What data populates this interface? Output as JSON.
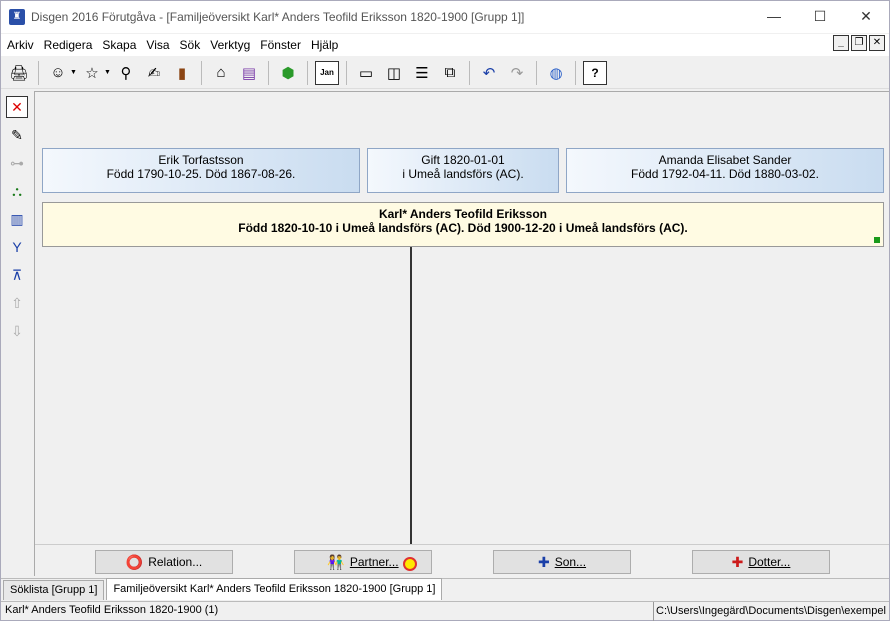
{
  "window": {
    "title": "Disgen 2016 Förutgåva - [Familjeöversikt Karl* Anders Teofild Eriksson 1820-1900 [Grupp 1]]"
  },
  "menu": [
    "Arkiv",
    "Redigera",
    "Skapa",
    "Visa",
    "Sök",
    "Verktyg",
    "Fönster",
    "Hjälp"
  ],
  "toolbar": {
    "calendar_label": "Jan"
  },
  "family": {
    "father": {
      "name": "Erik Torfastsson",
      "details": "Född 1790-10-25. Död 1867-08-26."
    },
    "marriage": {
      "line1": "Gift 1820-01-01",
      "line2": "i  Umeå landsförs (AC)."
    },
    "mother": {
      "name": "Amanda Elisabet Sander",
      "details": "Född 1792-04-11. Död 1880-03-02."
    },
    "main": {
      "name": "Karl* Anders Teofild Eriksson",
      "details": "Född 1820-10-10 i Umeå landsförs (AC). Död 1900-12-20 i Umeå landsförs (AC)."
    }
  },
  "buttons": {
    "relation": "Relation...",
    "partner": "Partner...",
    "son": "Son...",
    "daughter": "Dotter..."
  },
  "tabs": [
    "Söklista [Grupp 1]",
    "Familjeöversikt Karl* Anders Teofild Eriksson 1820-1900 [Grupp 1]"
  ],
  "status": {
    "left": "Karl* Anders Teofild Eriksson 1820-1900 (1)",
    "right": "C:\\Users\\Ingegärd\\Documents\\Disgen\\exempel"
  },
  "colors": {
    "person_box_start": "#f4f8fd",
    "person_box_end": "#c9dcf0",
    "main_box": "#fffbe3",
    "status_dot": "#1a9a1a"
  }
}
